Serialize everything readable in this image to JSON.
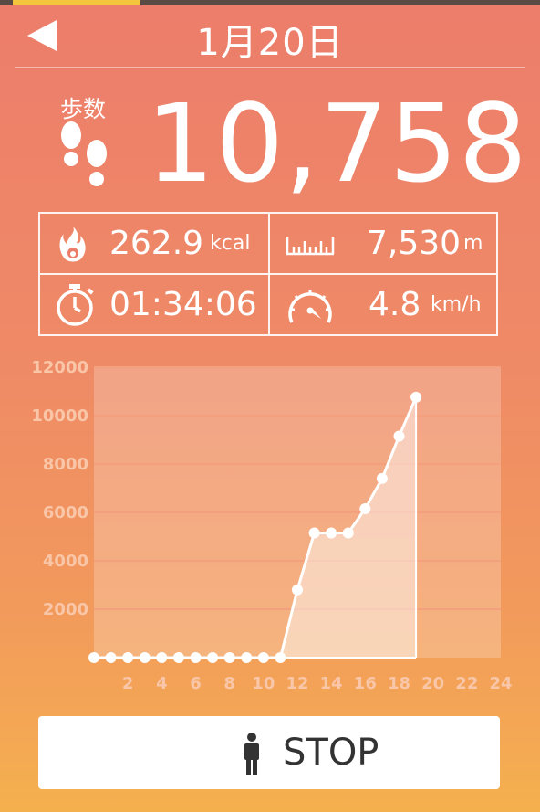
{
  "header": {
    "date": "1月20日"
  },
  "summary": {
    "steps_label": "歩数",
    "steps": "10,758"
  },
  "stats": {
    "calories": {
      "value": "262.9",
      "unit": "kcal"
    },
    "distance": {
      "value": "7,530",
      "unit": "m"
    },
    "time": {
      "value": "01:34:06"
    },
    "speed": {
      "value": "4.8",
      "unit": "km/h"
    }
  },
  "chart_data": {
    "type": "area",
    "x": [
      0,
      1,
      2,
      3,
      4,
      5,
      6,
      7,
      8,
      9,
      10,
      11,
      12,
      13,
      14,
      15,
      16,
      17,
      18,
      19
    ],
    "values": [
      0,
      0,
      0,
      0,
      0,
      0,
      0,
      0,
      0,
      0,
      0,
      0,
      2800,
      5150,
      5150,
      5150,
      6150,
      7400,
      9150,
      10758
    ],
    "xticks": [
      2,
      4,
      6,
      8,
      10,
      12,
      14,
      16,
      18,
      20,
      22,
      24
    ],
    "yticks": [
      2000,
      4000,
      6000,
      8000,
      10000,
      12000
    ],
    "xlim": [
      0,
      24
    ],
    "ylim": [
      0,
      12000
    ],
    "grid": true
  },
  "stop_button": {
    "label": "STOP"
  },
  "colors": {
    "chart_line": "#ffffff",
    "grid": "#f2a07e",
    "tick": "#f9c6a8"
  }
}
